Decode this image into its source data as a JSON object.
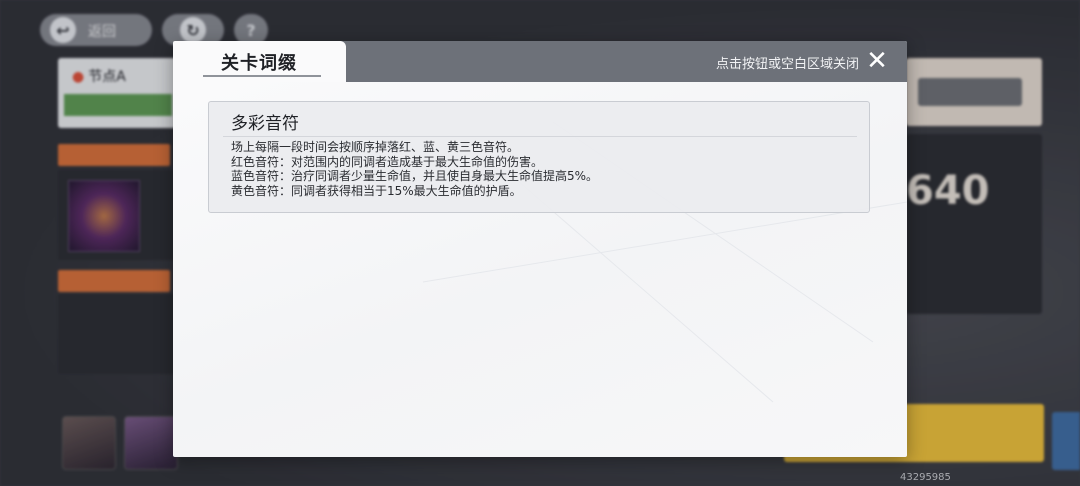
{
  "background": {
    "back_label": "返回",
    "node_label": "节点A",
    "help_icon": "?",
    "score": "640",
    "uid": "43295985"
  },
  "dialog": {
    "tab_title": "关卡词缀",
    "close_hint": "点击按钮或空白区域关闭",
    "close_icon": "✕",
    "affix": {
      "title": "多彩音符",
      "lines": [
        "场上每隔一段时间会按顺序掉落红、蓝、黄三色音符。",
        "红色音符：对范围内的同调者造成基于最大生命值的伤害。",
        "蓝色音符：治疗同调者少量生命值，并且使自身最大生命值提高5%。",
        "黄色音符：同调者获得相当于15%最大生命值的护盾。"
      ]
    }
  },
  "colors": {
    "header": "#6d7179",
    "accent_orange": "#d9713a",
    "accent_green": "#5e9c55",
    "accent_yellow": "#f0c23b"
  }
}
